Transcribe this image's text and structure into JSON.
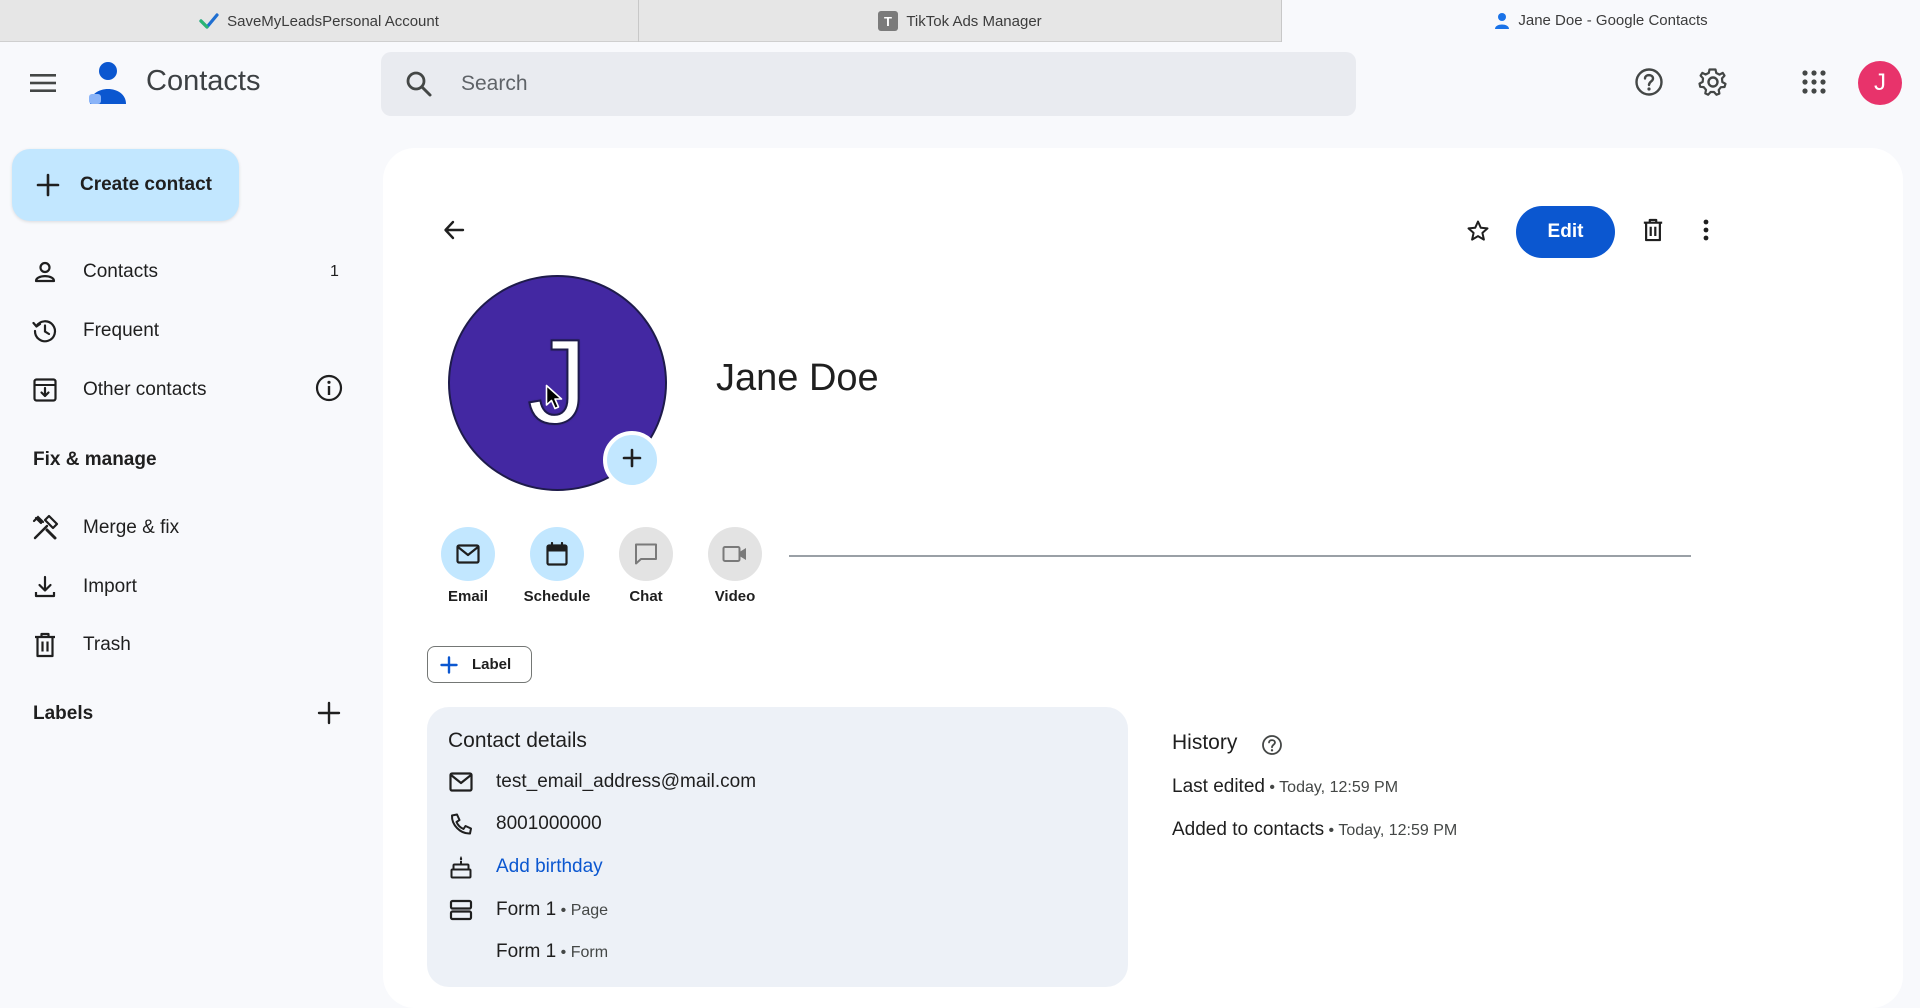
{
  "browser": {
    "tabs": [
      {
        "title": "SaveMyLeadsPersonal Account",
        "icon": "check-icon"
      },
      {
        "title": "TikTok Ads Manager",
        "icon": "tiktok-icon"
      },
      {
        "title": "Jane Doe - Google Contacts",
        "icon": "person-icon",
        "active": true
      }
    ]
  },
  "header": {
    "app_title": "Contacts",
    "search_placeholder": "Search",
    "avatar_letter": "J",
    "avatar_color": "#e8336b"
  },
  "sidebar": {
    "create_label": "Create contact",
    "items": [
      {
        "label": "Contacts",
        "count": "1",
        "icon": "person-icon"
      },
      {
        "label": "Frequent",
        "icon": "history-icon"
      },
      {
        "label": "Other contacts",
        "icon": "archive-download-icon"
      }
    ],
    "fix_heading": "Fix & manage",
    "fix_items": [
      {
        "label": "Merge & fix",
        "icon": "tools-icon"
      },
      {
        "label": "Import",
        "icon": "download-icon"
      },
      {
        "label": "Trash",
        "icon": "trash-icon"
      }
    ],
    "labels_heading": "Labels"
  },
  "contact": {
    "name": "Jane Doe",
    "initial": "J",
    "photo_color": "#4328a2",
    "edit_label": "Edit",
    "actions": [
      {
        "label": "Email",
        "icon": "mail-icon",
        "enabled": true
      },
      {
        "label": "Schedule",
        "icon": "calendar-icon",
        "enabled": true
      },
      {
        "label": "Chat",
        "icon": "chat-icon",
        "enabled": false
      },
      {
        "label": "Video",
        "icon": "video-icon",
        "enabled": false
      }
    ],
    "label_button": "Label",
    "details": {
      "title": "Contact details",
      "email": "test_email_address@mail.com",
      "phone": "8001000000",
      "birthday_link": "Add birthday",
      "forms": [
        {
          "name": "Form 1",
          "sep": " • ",
          "type": "Page"
        },
        {
          "name": "Form 1",
          "sep": " • ",
          "type": "Form"
        }
      ]
    },
    "history": {
      "title": "History",
      "rows": [
        {
          "label": "Last edited",
          "sep": " • ",
          "time": "Today, 12:59 PM"
        },
        {
          "label": "Added to contacts",
          "sep": " • ",
          "time": "Today, 12:59 PM"
        }
      ]
    }
  },
  "colors": {
    "accent": "#0b57d0",
    "light_accent": "#c2e7ff"
  }
}
